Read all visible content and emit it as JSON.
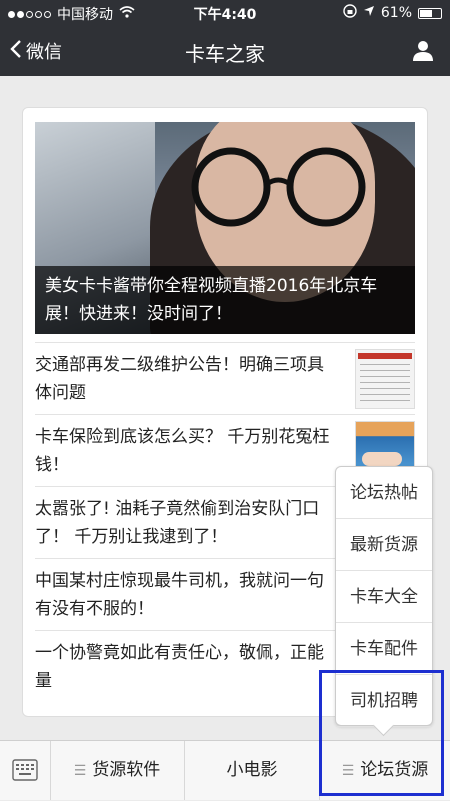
{
  "status_bar": {
    "carrier": "中国移动",
    "time": "下午4:40",
    "battery": "61%",
    "signal_dots_filled": 2,
    "signal_dots_total": 5,
    "battery_level": 0.61
  },
  "nav": {
    "back_label": "微信",
    "title": "卡车之家"
  },
  "hero": {
    "caption": "美女卡卡酱带你全程视频直播2016年北京车展！快进来！没时间了！"
  },
  "articles": [
    {
      "title": "交通部再发二级维护公告！明确三项具体问题"
    },
    {
      "title": "卡车保险到底该怎么买？ 千万别花冤枉钱！"
    },
    {
      "title": "太嚣张了! 油耗子竟然偷到治安队门口了！ 千万别让我逮到了！"
    },
    {
      "title": "中国某村庄惊现最牛司机，我就问一句有没有不服的！"
    },
    {
      "title": "一个协警竟如此有责任心，敬佩，正能量"
    }
  ],
  "popup_menu": {
    "items": [
      "论坛热帖",
      "最新货源",
      "卡车大全",
      "卡车配件",
      "司机招聘"
    ]
  },
  "bottom_bar": {
    "tabs": [
      "货源软件",
      "小电影",
      "论坛货源"
    ]
  },
  "colors": {
    "nav_bg": "#2f3136",
    "highlight": "#1d2fd0",
    "page_bg": "#ebebeb"
  }
}
